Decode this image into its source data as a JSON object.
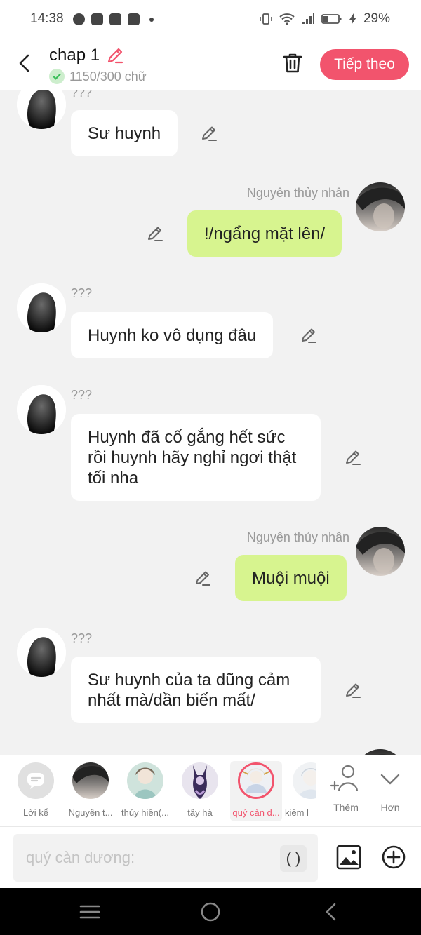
{
  "status": {
    "time": "14:38",
    "battery": "29%"
  },
  "header": {
    "title": "chap 1",
    "char_count": "1150/300 chữ",
    "next_label": "Tiếp theo"
  },
  "messages": [
    {
      "name": "???",
      "text": "Sư huynh"
    },
    {
      "name": "Nguyên thủy nhân",
      "text": "!/ngẩng mặt lên/"
    },
    {
      "name": "???",
      "text": "Huynh ko vô dụng đâu"
    },
    {
      "name": "???",
      "text": "Huynh đã cố gắng hết sức rồi huynh hãy nghỉ ngơi thật tối nha"
    },
    {
      "name": "Nguyên thủy nhân",
      "text": "Muội muội"
    },
    {
      "name": "???",
      "text": "Sư huynh của ta dũng cảm nhất mà/dần biến mất/"
    }
  ],
  "characters": [
    {
      "label": "Lời kể"
    },
    {
      "label": "Nguyên t..."
    },
    {
      "label": "thủy hiên(..."
    },
    {
      "label": "tây hà"
    },
    {
      "label": "quý càn d..."
    },
    {
      "label": "kiếm l"
    }
  ],
  "tools": {
    "more_label": "Thêm",
    "expand_label": "Hơn"
  },
  "input": {
    "placeholder": "quý càn dương:",
    "paren": "( )"
  },
  "colors": {
    "accent": "#f2546d",
    "bubble_right": "#d7f48f",
    "bubble_left": "#ffffff",
    "background": "#f2f2f2"
  }
}
